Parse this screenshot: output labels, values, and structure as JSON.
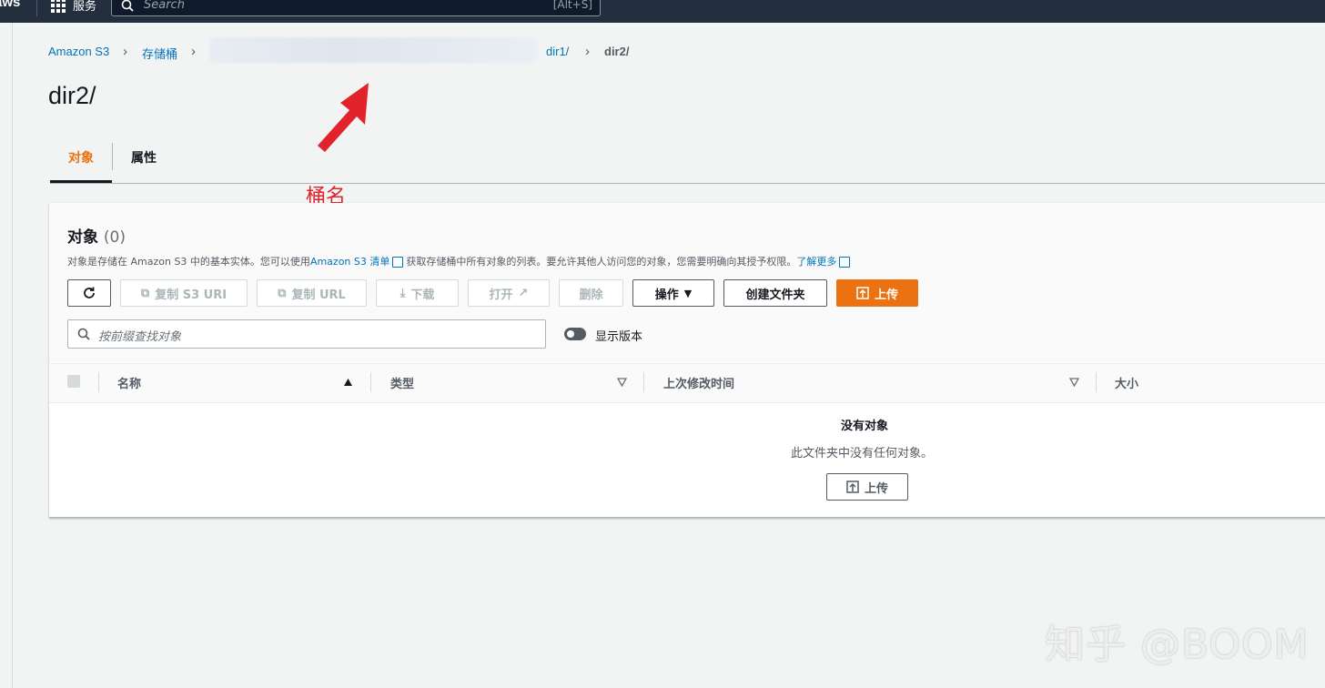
{
  "nav": {
    "logo": "aws",
    "services_label": "服务",
    "search_placeholder": "Search",
    "search_shortcut": "[Alt+S]"
  },
  "breadcrumb": {
    "items": [
      "Amazon S3",
      "存储桶",
      "dir1/"
    ],
    "current": "dir2/"
  },
  "page_title": "dir2/",
  "tabs": [
    {
      "label": "对象",
      "active": true
    },
    {
      "label": "属性",
      "active": false
    }
  ],
  "annotation": {
    "label": "桶名",
    "color": "#e1232c"
  },
  "objects_panel": {
    "title": "对象",
    "count": "(0)",
    "desc_part1": "对象是存储在 Amazon S3 中的基本实体。您可以使用",
    "desc_link1": "Amazon S3 清单",
    "desc_part2": "获取存储桶中所有对象的列表。要允许其他人访问您的对象，您需要明确向其授予权限。",
    "desc_link2": "了解更多",
    "buttons": {
      "copy_s3_uri": "复制 S3 URI",
      "copy_url": "复制 URL",
      "download": "下载",
      "open": "打开",
      "delete": "删除",
      "actions": "操作",
      "create_folder": "创建文件夹",
      "upload": "上传"
    },
    "filter_placeholder": "按前缀查找对象",
    "show_versions": "显示版本",
    "columns": [
      "名称",
      "类型",
      "上次修改时间",
      "大小"
    ],
    "empty_title": "没有对象",
    "empty_desc": "此文件夹中没有任何对象。",
    "empty_upload": "上传"
  },
  "watermark": "知乎 @BOOM",
  "colors": {
    "accent": "#ec7211",
    "link": "#0073bb",
    "nav_bg": "#232f3e"
  }
}
